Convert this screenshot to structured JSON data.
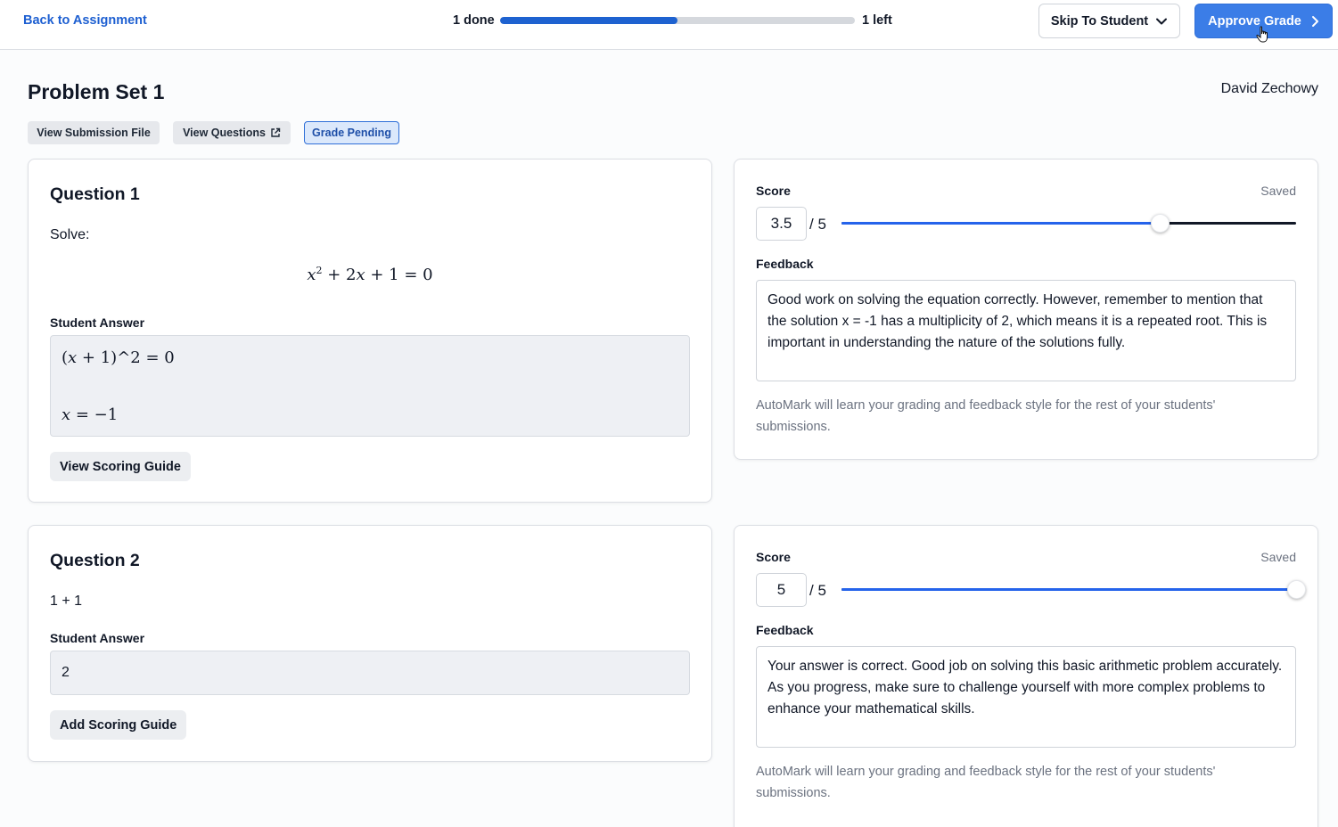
{
  "topbar": {
    "back_link": "Back to Assignment",
    "progress_done": "1 done",
    "progress_left": "1 left",
    "progress_fraction": 0.5,
    "skip_button": "Skip To Student",
    "approve_button": "Approve Grade",
    "accent_color": "#3b7de7"
  },
  "header": {
    "title": "Problem Set 1",
    "student_name": "David Zechowy",
    "view_submission": "View Submission File",
    "view_questions": "View Questions",
    "status_badge": "Grade Pending"
  },
  "questions": [
    {
      "title": "Question 1",
      "prompt": "Solve:",
      "equation": "x^2 + 2x + 1 = 0",
      "student_answer_label": "Student Answer",
      "answer_line1": "(x + 1)^2 = 0",
      "answer_line2": "x = −1",
      "guide_button": "View Scoring Guide",
      "score_label": "Score",
      "saved": "Saved",
      "score": "3.5",
      "score_max": "/ 5",
      "score_fraction": 0.7,
      "feedback_label": "Feedback",
      "feedback": "Good work on solving the equation correctly. However, remember to mention that the solution x = -1 has a multiplicity of 2, which means it is a repeated root. This is important in understanding the nature of the solutions fully.",
      "note": "AutoMark will learn your grading and feedback style for the rest of your students' submissions."
    },
    {
      "title": "Question 2",
      "prompt": "1 + 1",
      "student_answer_label": "Student Answer",
      "answer": "2",
      "guide_button": "Add Scoring Guide",
      "score_label": "Score",
      "saved": "Saved",
      "score": "5",
      "score_max": "/ 5",
      "score_fraction": 1.0,
      "feedback_label": "Feedback",
      "feedback": "Your answer is correct. Good job on solving this basic arithmetic problem accurately. As you progress, make sure to challenge yourself with more complex problems to enhance your mathematical skills.",
      "note": "AutoMark will learn your grading and feedback style for the rest of your students' submissions."
    }
  ]
}
